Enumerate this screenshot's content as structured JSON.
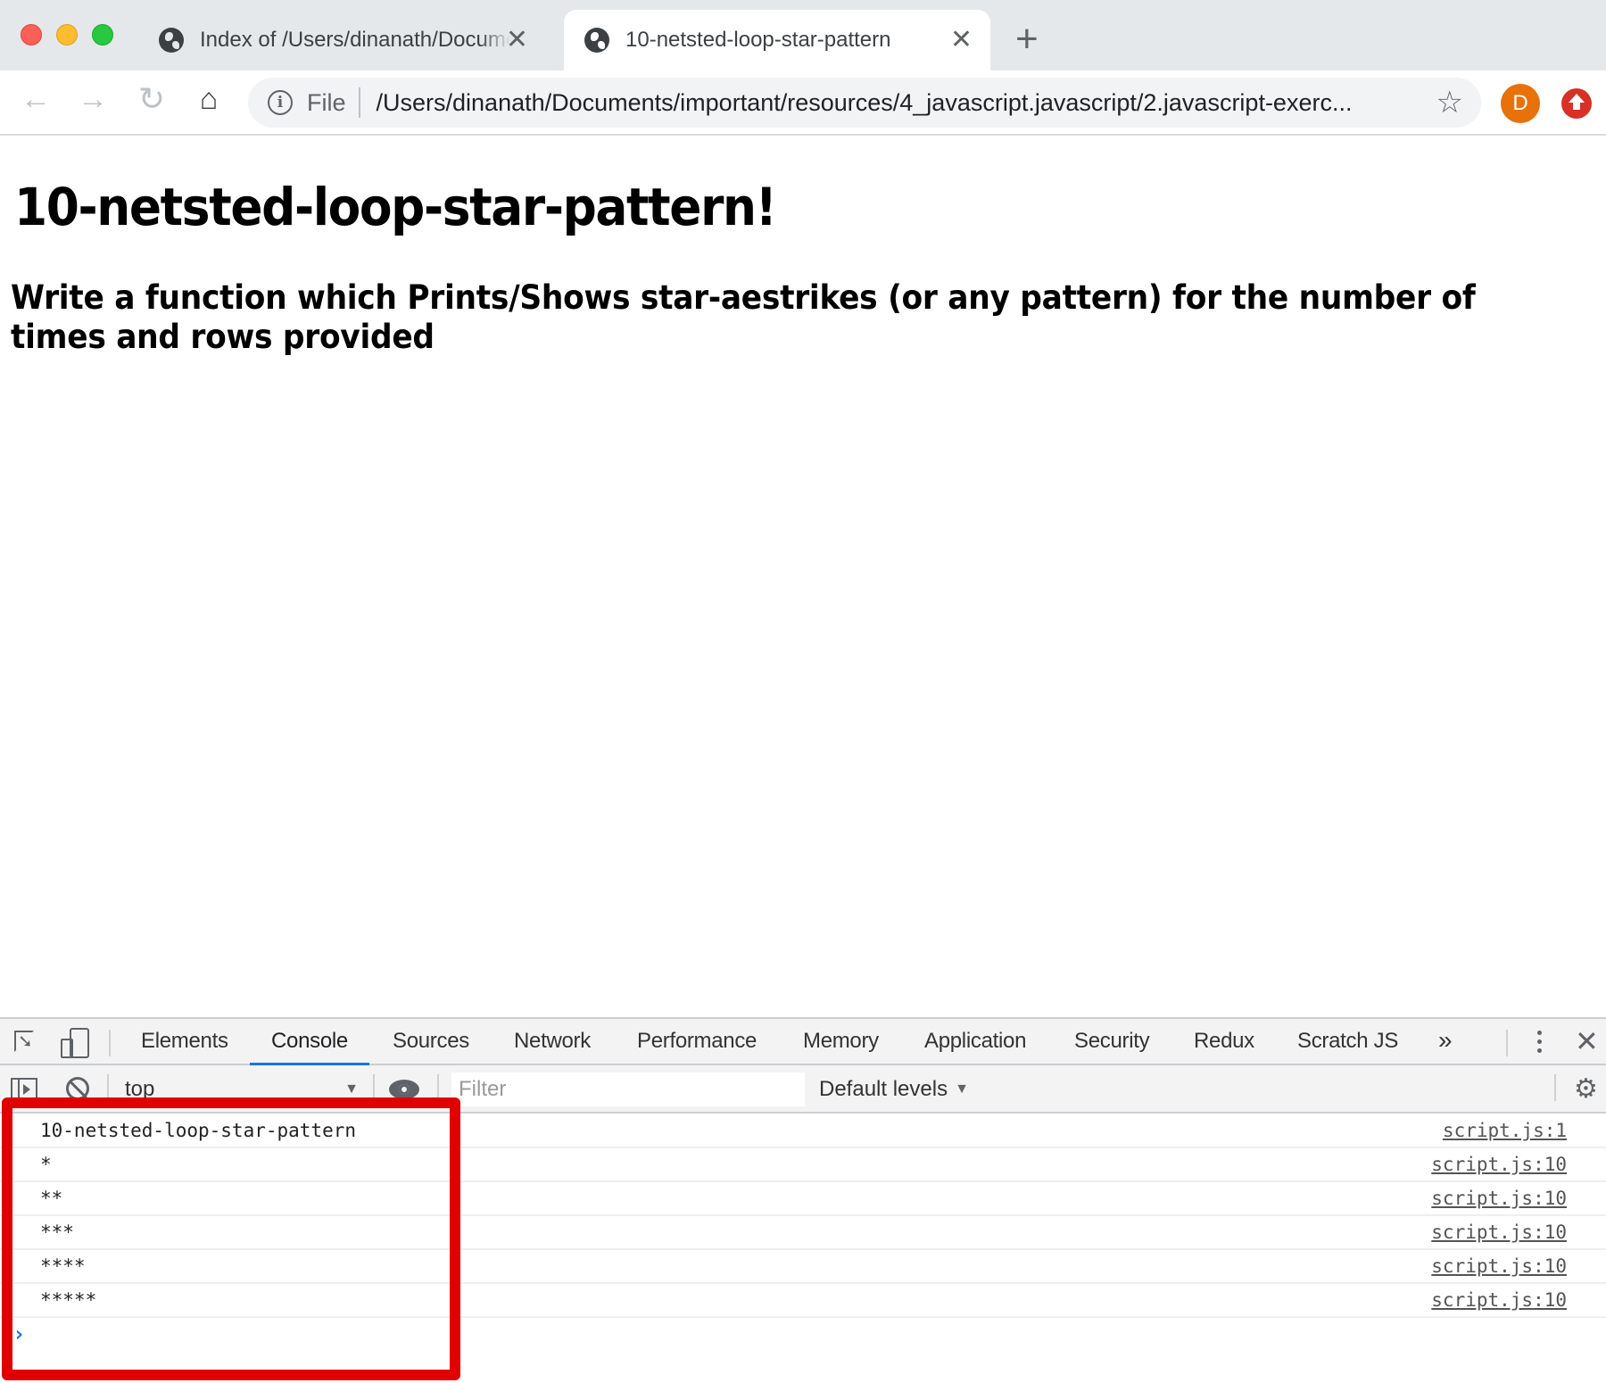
{
  "browser": {
    "tabs": [
      {
        "title": "Index of /Users/dinanath/Documents/important/resources",
        "active": false,
        "icon": "globe-icon"
      },
      {
        "title": "10-netsted-loop-star-pattern",
        "active": true,
        "icon": "globe-icon"
      }
    ],
    "new_tab_label": "+",
    "close_glyph": "✕",
    "address_bar": {
      "scheme_label": "File",
      "url": "/Users/dinanath/Documents/important/resources/4_javascript.javascript/2.javascript-exerc..."
    },
    "profile_initial": "D",
    "nav_glyphs": {
      "back": "←",
      "forward": "→",
      "reload": "↻",
      "home": "⌂",
      "star": "☆",
      "info": "i"
    }
  },
  "page": {
    "title": "10-netsted-loop-star-pattern!",
    "subtitle": "Write a function which Prints/Shows star-aestrikes (or any pattern) for the number of times and rows provided"
  },
  "devtools": {
    "tabs": [
      "Elements",
      "Console",
      "Sources",
      "Network",
      "Performance",
      "Memory",
      "Application",
      "Security",
      "Redux",
      "Scratch JS"
    ],
    "active_tab": "Console",
    "more_glyph": "»",
    "close_glyph": "✕",
    "context": "top",
    "filter_placeholder": "Filter",
    "levels_label": "Default levels",
    "caret": "▼",
    "gear_glyph": "⚙",
    "prompt_glyph": "›",
    "console_logs": [
      {
        "message": "10-netsted-loop-star-pattern",
        "source": "script.js:1"
      },
      {
        "message": "*",
        "source": "script.js:10"
      },
      {
        "message": "**",
        "source": "script.js:10"
      },
      {
        "message": "***",
        "source": "script.js:10"
      },
      {
        "message": "****",
        "source": "script.js:10"
      },
      {
        "message": "*****",
        "source": "script.js:10"
      }
    ]
  },
  "annotation": {
    "highlight_color": "#e10000"
  }
}
